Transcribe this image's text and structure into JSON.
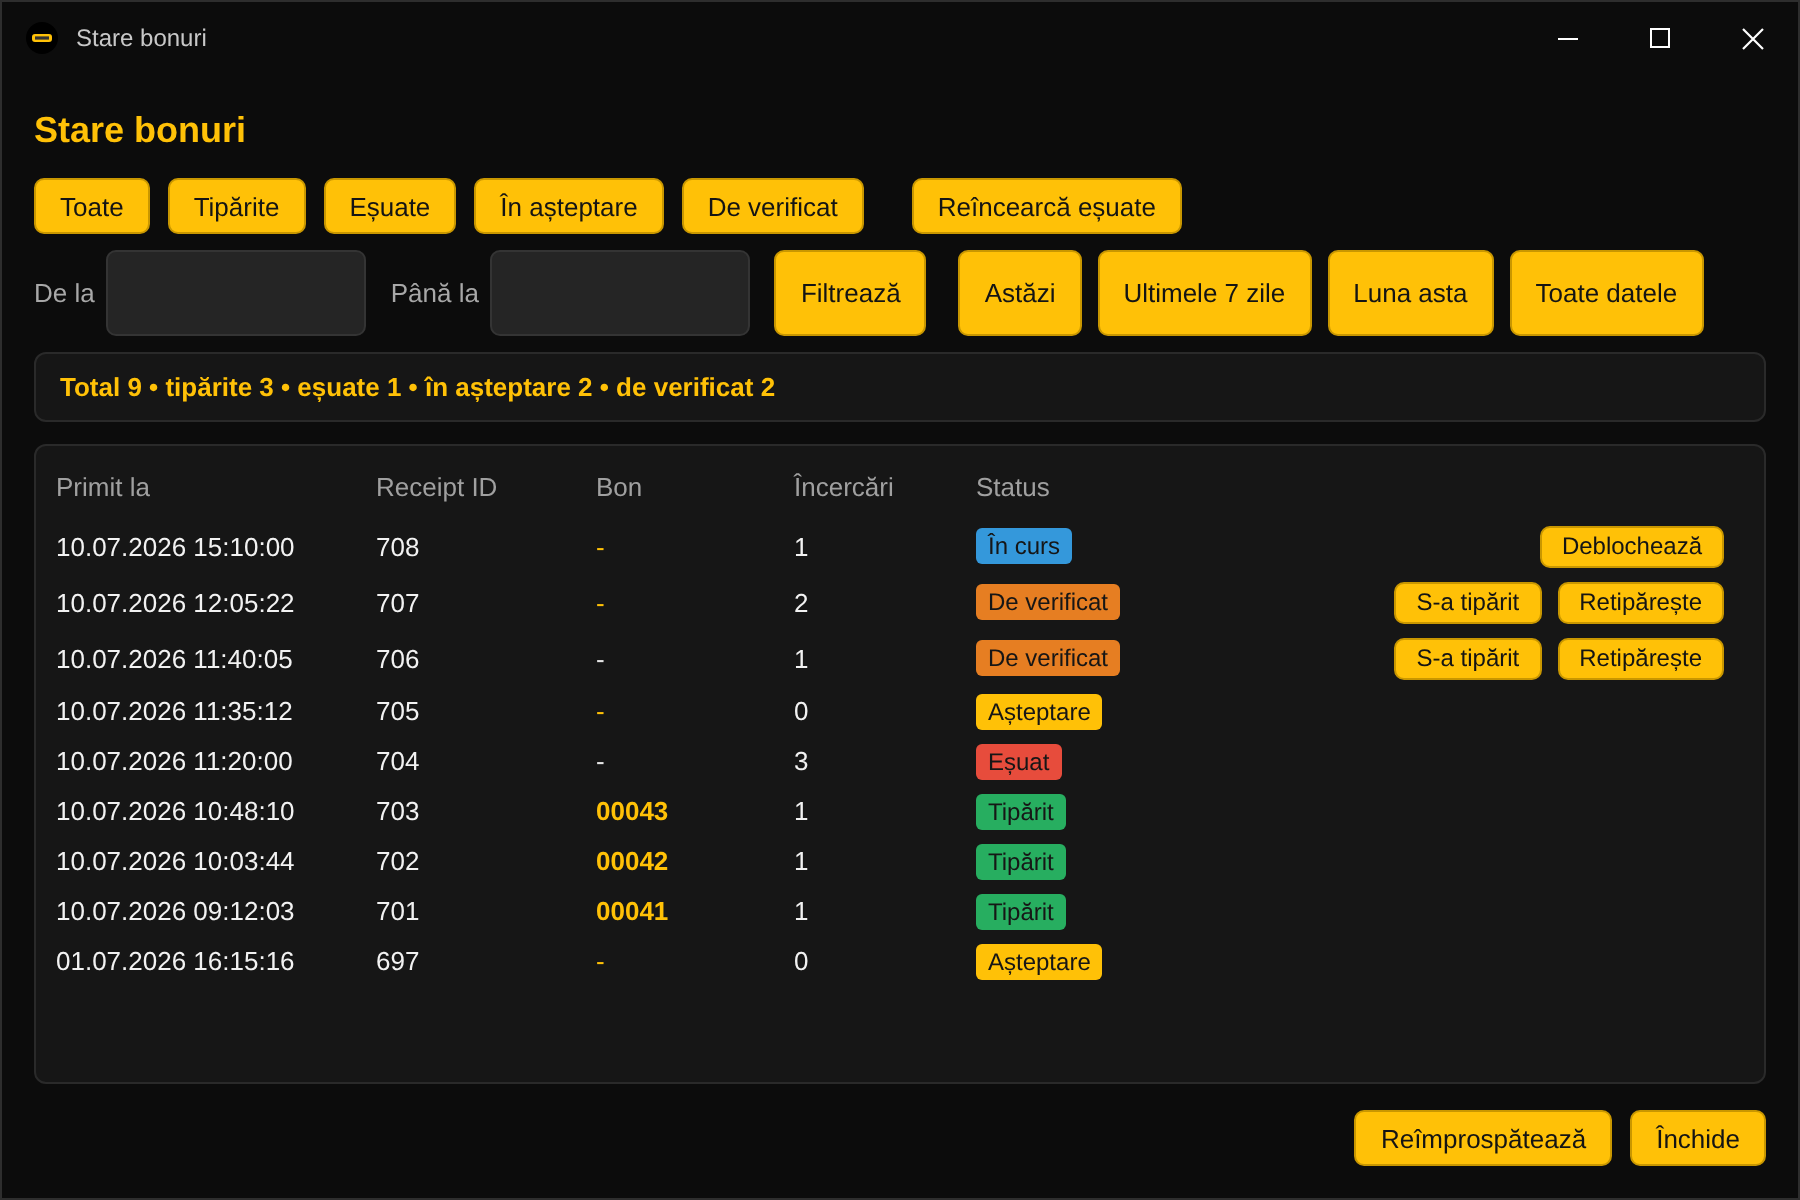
{
  "window": {
    "title": "Stare bonuri"
  },
  "heading": "Stare bonuri",
  "filter_buttons": [
    "Toate",
    "Tipărite",
    "Eșuate",
    "În așteptare",
    "De verificat"
  ],
  "retry_button": "Reîncearcă eșuate",
  "date_filter": {
    "from_label": "De la",
    "to_label": "Până la",
    "apply_button": "Filtrează",
    "presets": [
      "Astăzi",
      "Ultimele 7 zile",
      "Luna asta",
      "Toate datele"
    ]
  },
  "summary": "Total 9 • tipărite 3 • eșuate 1 • în așteptare 2 • de verificat 2",
  "table": {
    "columns": [
      "Primit la",
      "Receipt ID",
      "Bon",
      "Încercări",
      "Status"
    ],
    "rows": [
      {
        "received": "10.07.2026 15:10:00",
        "receipt_id": "708",
        "bon": "-",
        "bon_accent": true,
        "attempts": "1",
        "status": {
          "label": "În curs",
          "color": "#3498db"
        },
        "actions": [
          "Deblochează"
        ]
      },
      {
        "received": "10.07.2026 12:05:22",
        "receipt_id": "707",
        "bon": "-",
        "bon_accent": true,
        "attempts": "2",
        "status": {
          "label": "De verificat",
          "color": "#e67e22"
        },
        "actions": [
          "S-a tipărit",
          "Retipărește"
        ]
      },
      {
        "received": "10.07.2026 11:40:05",
        "receipt_id": "706",
        "bon": "-",
        "bon_accent": false,
        "attempts": "1",
        "status": {
          "label": "De verificat",
          "color": "#e67e22"
        },
        "actions": [
          "S-a tipărit",
          "Retipărește"
        ]
      },
      {
        "received": "10.07.2026 11:35:12",
        "receipt_id": "705",
        "bon": "-",
        "bon_accent": true,
        "attempts": "0",
        "status": {
          "label": "Așteptare",
          "color": "#ffc107"
        }
      },
      {
        "received": "10.07.2026 11:20:00",
        "receipt_id": "704",
        "bon": "-",
        "bon_accent": false,
        "attempts": "3",
        "status": {
          "label": "Eșuat",
          "color": "#e74c3c"
        }
      },
      {
        "received": "10.07.2026 10:48:10",
        "receipt_id": "703",
        "bon": "00043",
        "bon_accent": true,
        "attempts": "1",
        "status": {
          "label": "Tipărit",
          "color": "#27ae60"
        }
      },
      {
        "received": "10.07.2026 10:03:44",
        "receipt_id": "702",
        "bon": "00042",
        "bon_accent": true,
        "attempts": "1",
        "status": {
          "label": "Tipărit",
          "color": "#27ae60"
        }
      },
      {
        "received": "10.07.2026 09:12:03",
        "receipt_id": "701",
        "bon": "00041",
        "bon_accent": true,
        "attempts": "1",
        "status": {
          "label": "Tipărit",
          "color": "#27ae60"
        }
      },
      {
        "received": "01.07.2026 16:15:16",
        "receipt_id": "697",
        "bon": "-",
        "bon_accent": true,
        "attempts": "0",
        "status": {
          "label": "Așteptare",
          "color": "#ffc107"
        }
      }
    ]
  },
  "footer_buttons": [
    "Reîmprospătează",
    "Închide"
  ]
}
